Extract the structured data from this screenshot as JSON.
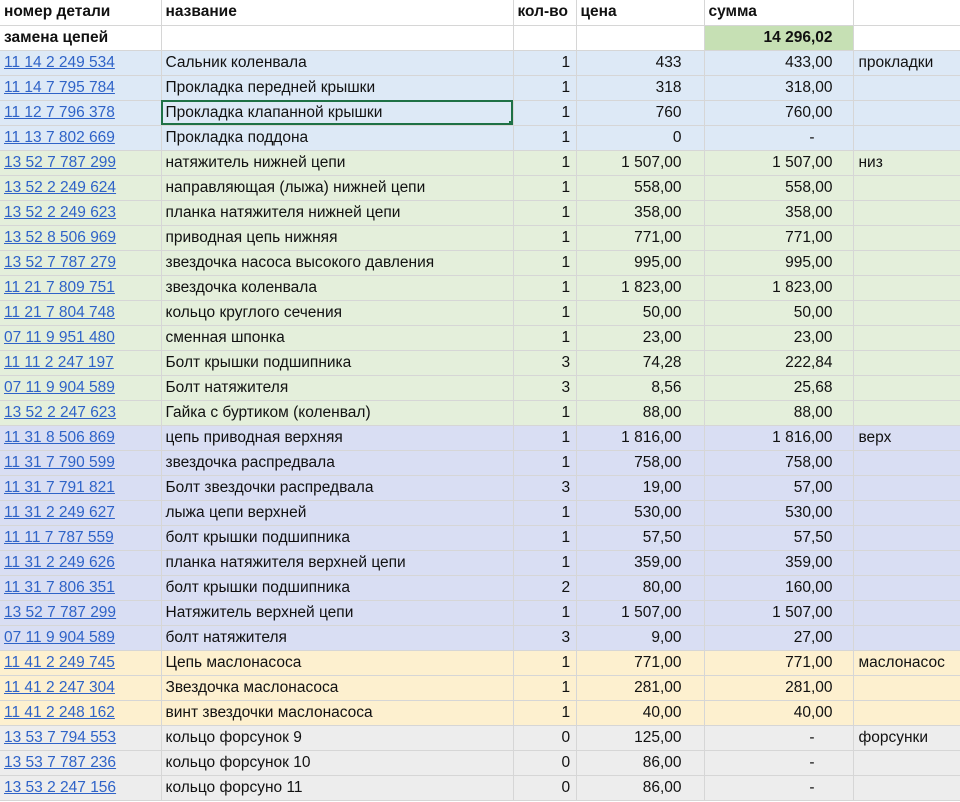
{
  "header": {
    "part": "номер детали",
    "name": "название",
    "qty": "кол-во",
    "price": "цена",
    "sum": "сумма"
  },
  "subheader": {
    "label": "замена цепей",
    "total": "14 296,02"
  },
  "colors": {
    "gaskets": "#dde9f6",
    "lower": "#e4efdb",
    "upper": "#d9def3",
    "oilpump": "#fdf0cf",
    "injectors": "#ededed",
    "total": "#c6e0b4",
    "link": "#2f63c8"
  },
  "rows": [
    {
      "part": "11 14 2 249 534",
      "name": "Сальник коленвала",
      "qty": "1",
      "price": "433",
      "sum": "433,00",
      "group": "прокладки"
    },
    {
      "part": "11 14 7 795 784",
      "name": "Прокладка передней крышки",
      "qty": "1",
      "price": "318",
      "sum": "318,00",
      "group": ""
    },
    {
      "part": "11 12 7 796 378",
      "name": "Прокладка клапанной крышки",
      "qty": "1",
      "price": "760",
      "sum": "760,00",
      "group": ""
    },
    {
      "part": "11 13 7 802 669",
      "name": "Прокладка поддона",
      "qty": "1",
      "price": "0",
      "sum": "-",
      "group": ""
    },
    {
      "part": "13 52 7 787 299",
      "name": "натяжитель нижней цепи",
      "qty": "1",
      "price": "1 507,00",
      "sum": "1 507,00",
      "group": "низ"
    },
    {
      "part": "13 52 2 249 624",
      "name": "направляющая (лыжа) нижней цепи",
      "qty": "1",
      "price": "558,00",
      "sum": "558,00",
      "group": ""
    },
    {
      "part": "13 52 2 249 623",
      "name": "планка натяжителя нижней цепи",
      "qty": "1",
      "price": "358,00",
      "sum": "358,00",
      "group": ""
    },
    {
      "part": "13 52 8 506 969",
      "name": "приводная цепь нижняя",
      "qty": "1",
      "price": "771,00",
      "sum": "771,00",
      "group": ""
    },
    {
      "part": "13 52 7 787 279",
      "name": "звездочка насоса высокого давления",
      "qty": "1",
      "price": "995,00",
      "sum": "995,00",
      "group": ""
    },
    {
      "part": "11 21 7 809 751",
      "name": "звездочка коленвала",
      "qty": "1",
      "price": "1 823,00",
      "sum": "1 823,00",
      "group": ""
    },
    {
      "part": "11 21 7 804 748",
      "name": "кольцо круглого сечения",
      "qty": "1",
      "price": "50,00",
      "sum": "50,00",
      "group": ""
    },
    {
      "part": "07 11 9 951 480",
      "name": "сменная шпонка",
      "qty": "1",
      "price": "23,00",
      "sum": "23,00",
      "group": ""
    },
    {
      "part": "11 11 2 247 197",
      "name": "Болт крышки подшипника",
      "qty": "3",
      "price": "74,28",
      "sum": "222,84",
      "group": ""
    },
    {
      "part": "07 11 9 904 589",
      "name": "Болт натяжителя",
      "qty": "3",
      "price": "8,56",
      "sum": "25,68",
      "group": ""
    },
    {
      "part": "13 52 2 247 623",
      "name": "Гайка с буртиком (коленвал)",
      "qty": "1",
      "price": "88,00",
      "sum": "88,00",
      "group": ""
    },
    {
      "part": "11 31 8 506 869",
      "name": "цепь приводная верхняя",
      "qty": "1",
      "price": "1 816,00",
      "sum": "1 816,00",
      "group": "верх"
    },
    {
      "part": "11 31 7 790 599",
      "name": "звездочка распредвала",
      "qty": "1",
      "price": "758,00",
      "sum": "758,00",
      "group": ""
    },
    {
      "part": "11 31 7 791 821",
      "name": "Болт звездочки распредвала",
      "qty": "3",
      "price": "19,00",
      "sum": "57,00",
      "group": ""
    },
    {
      "part": "11 31 2 249 627",
      "name": "лыжа цепи верхней",
      "qty": "1",
      "price": "530,00",
      "sum": "530,00",
      "group": ""
    },
    {
      "part": "11 11 7 787 559",
      "name": "болт крышки подшипника",
      "qty": "1",
      "price": "57,50",
      "sum": "57,50",
      "group": ""
    },
    {
      "part": "11 31 2 249 626",
      "name": "планка натяжителя верхней цепи",
      "qty": "1",
      "price": "359,00",
      "sum": "359,00",
      "group": ""
    },
    {
      "part": "11 31 7 806 351",
      "name": "болт крышки подшипника",
      "qty": "2",
      "price": "80,00",
      "sum": "160,00",
      "group": ""
    },
    {
      "part": "13 52 7 787 299",
      "name": "Натяжитель верхней цепи",
      "qty": "1",
      "price": "1 507,00",
      "sum": "1 507,00",
      "group": ""
    },
    {
      "part": "07 11 9 904 589",
      "name": "болт натяжителя",
      "qty": "3",
      "price": "9,00",
      "sum": "27,00",
      "group": ""
    },
    {
      "part": "11 41 2 249 745",
      "name": "Цепь маслонасоса",
      "qty": "1",
      "price": "771,00",
      "sum": "771,00",
      "group": "маслонасос"
    },
    {
      "part": "11 41 2 247 304",
      "name": "Звездочка маслонасоса",
      "qty": "1",
      "price": "281,00",
      "sum": "281,00",
      "group": ""
    },
    {
      "part": "11 41 2 248 162",
      "name": "винт звездочки маслонасоса",
      "qty": "1",
      "price": "40,00",
      "sum": "40,00",
      "group": ""
    },
    {
      "part": "13 53 7 794 553",
      "name": "кольцо форсунок 9",
      "qty": "0",
      "price": "125,00",
      "sum": "-",
      "group": "форсунки"
    },
    {
      "part": "13 53 7 787 236",
      "name": "кольцо форсунок 10",
      "qty": "0",
      "price": "86,00",
      "sum": "-",
      "group": ""
    },
    {
      "part": "13 53 2 247 156",
      "name": "кольцо форсуно 11",
      "qty": "0",
      "price": "86,00",
      "sum": "-",
      "group": ""
    }
  ]
}
